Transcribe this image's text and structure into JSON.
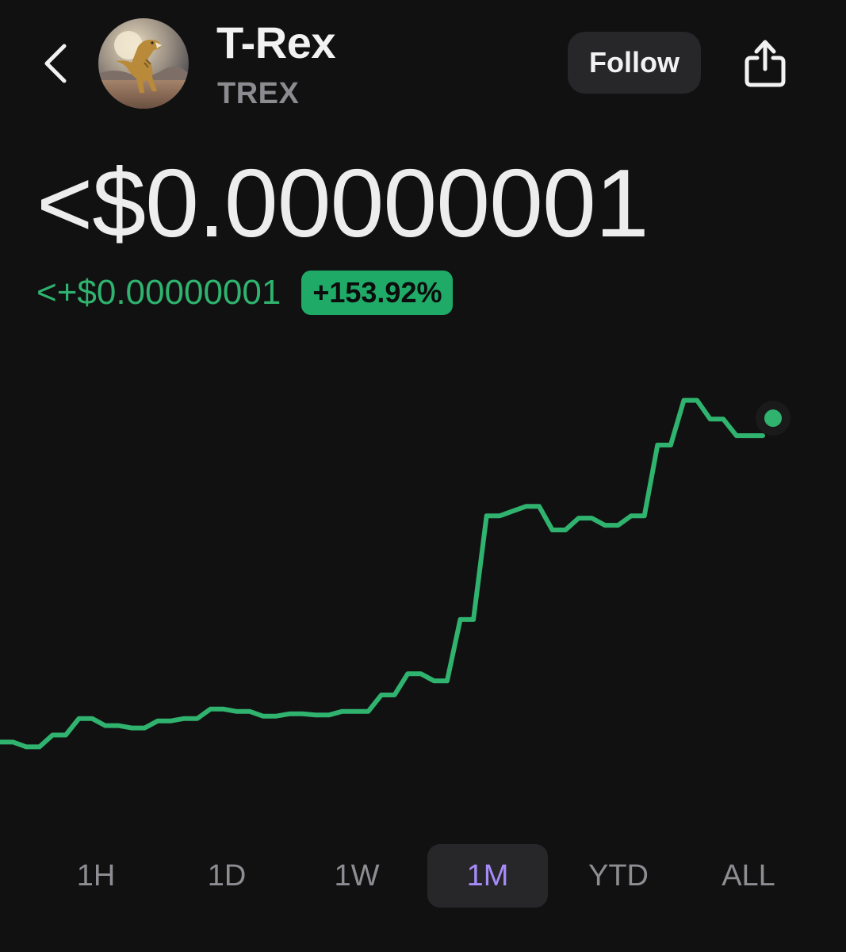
{
  "header": {
    "token_name": "T-Rex",
    "token_symbol": "TREX",
    "follow_label": "Follow"
  },
  "price": {
    "value": "<$0.00000001",
    "change_abs": "<+$0.00000001",
    "change_pct": "+153.92%"
  },
  "colors": {
    "background": "#111112",
    "accent_green": "#2fb36e",
    "badge_green": "#1faa67",
    "active_tab": "#a78bfa"
  },
  "ranges": {
    "tabs": [
      "1H",
      "1D",
      "1W",
      "1M",
      "YTD",
      "ALL"
    ],
    "active": "1M"
  },
  "chart_data": {
    "type": "line",
    "title": "",
    "xlabel": "",
    "ylabel": "",
    "grid": false,
    "series": [
      {
        "values": [
          100,
          100,
          98,
          98,
          103,
          103,
          110,
          110,
          107,
          107,
          106,
          106,
          109,
          109,
          110,
          110,
          114,
          114,
          113,
          113,
          111,
          111,
          112,
          112,
          111.5,
          111.5,
          113,
          113,
          113,
          120,
          120,
          129,
          129,
          126,
          126,
          152,
          152,
          196,
          196,
          198,
          200,
          200,
          190,
          190,
          195,
          195,
          192,
          192,
          196,
          196,
          226,
          226,
          245,
          245,
          237,
          237,
          230,
          230,
          230
        ]
      }
    ],
    "ylim": [
      85,
      260
    ],
    "last_point_marker": true
  }
}
